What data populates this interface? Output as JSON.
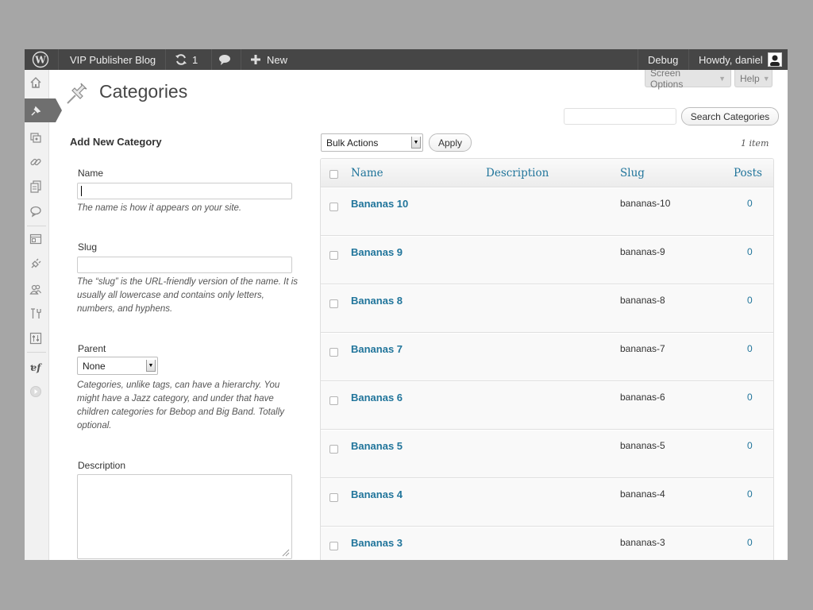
{
  "admin_bar": {
    "site_name": "VIP Publisher Blog",
    "updates_count": "1",
    "new_label": "New",
    "debug_label": "Debug",
    "howdy": "Howdy, daniel"
  },
  "screen_meta": {
    "screen_options": "Screen Options",
    "help": "Help"
  },
  "page": {
    "title": "Categories"
  },
  "search": {
    "button_label": "Search Categories",
    "value": ""
  },
  "form": {
    "heading": "Add New Category",
    "name_label": "Name",
    "name_help": "The name is how it appears on your site.",
    "slug_label": "Slug",
    "slug_help": "The “slug” is the URL-friendly version of the name. It is usually all lowercase and contains only letters, numbers, and hyphens.",
    "parent_label": "Parent",
    "parent_selected": "None",
    "parent_help": "Categories, unlike tags, can have a hierarchy. You might have a Jazz category, and under that have children categories for Bebop and Big Band. Totally optional.",
    "description_label": "Description"
  },
  "list": {
    "bulk_actions": "Bulk Actions",
    "apply_label": "Apply",
    "item_count": "1 item",
    "columns": {
      "name": "Name",
      "description": "Description",
      "slug": "Slug",
      "posts": "Posts"
    },
    "rows": [
      {
        "name": "Bananas 10",
        "description": "",
        "slug": "bananas-10",
        "posts": "0"
      },
      {
        "name": "Bananas 9",
        "description": "",
        "slug": "bananas-9",
        "posts": "0"
      },
      {
        "name": "Bananas 8",
        "description": "",
        "slug": "bananas-8",
        "posts": "0"
      },
      {
        "name": "Bananas 7",
        "description": "",
        "slug": "bananas-7",
        "posts": "0"
      },
      {
        "name": "Bananas 6",
        "description": "",
        "slug": "bananas-6",
        "posts": "0"
      },
      {
        "name": "Bananas 5",
        "description": "",
        "slug": "bananas-5",
        "posts": "0"
      },
      {
        "name": "Bananas 4",
        "description": "",
        "slug": "bananas-4",
        "posts": "0"
      },
      {
        "name": "Bananas 3",
        "description": "",
        "slug": "bananas-3",
        "posts": "0"
      }
    ]
  },
  "colors": {
    "admin_bar_bg": "#464646",
    "link": "#21759b",
    "backdrop": "#a6a6a6"
  },
  "icons": {
    "wordpress": "wordpress-logo-icon",
    "updates": "refresh-icon",
    "comments": "comment-bubble-icon",
    "new": "plus-icon",
    "pushpin": "pushpin-icon"
  }
}
